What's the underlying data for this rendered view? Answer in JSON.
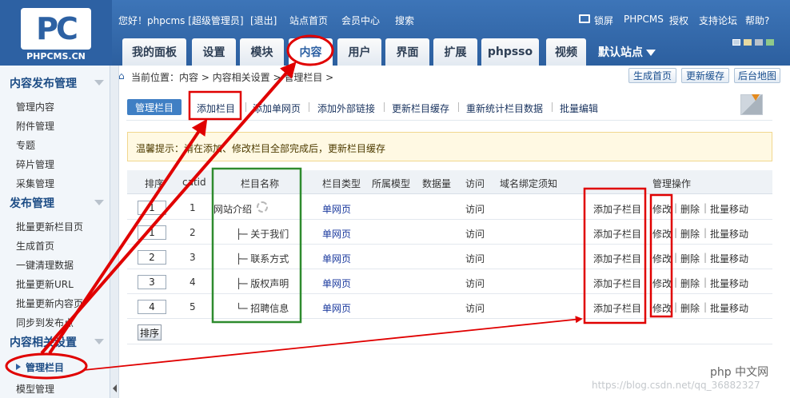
{
  "header": {
    "logo_glyph": "PC",
    "logo_text": "PHPCMS.CN",
    "greeting": "您好！phpcms [超级管理员]",
    "logout": "[退出]",
    "site_home": "站点首页",
    "member_center": "会员中心",
    "search": "搜索",
    "lock_screen": "锁屏",
    "phpcms": "PHPCMS",
    "license": "授权",
    "support_forum": "支持论坛",
    "help": "帮助?",
    "tabs": [
      "我的面板",
      "设置",
      "模块",
      "内容",
      "用户",
      "界面",
      "扩展",
      "phpsso",
      "视频"
    ],
    "site_select": "默认站点"
  },
  "sidebar": {
    "group1_title": "内容发布管理",
    "group1_items": [
      "管理内容",
      "附件管理",
      "专题",
      "碎片管理",
      "采集管理"
    ],
    "group2_title": "发布管理",
    "group2_items": [
      "批量更新栏目页",
      "生成首页",
      "一键清理数据",
      "批量更新URL",
      "批量更新内容页",
      "同步到发布点"
    ],
    "group3_title": "内容相关设置",
    "group3_items": [
      "管理栏目",
      "模型管理"
    ]
  },
  "breadcrumb": "当前位置：内容 > 内容相关设置 > 管理栏目 >",
  "top_buttons": {
    "generate_home": "生成首页",
    "update_cache": "更新缓存",
    "backend_map": "后台地图"
  },
  "subnav": [
    "管理栏目",
    "添加栏目",
    "添加单网页",
    "添加外部链接",
    "更新栏目缓存",
    "重新统计栏目数据",
    "批量编辑"
  ],
  "notice": "温馨提示：请在添加、修改栏目全部完成后，更新栏目缓存",
  "table": {
    "headers": {
      "sort": "排序",
      "catid": "catid",
      "name": "栏目名称",
      "type": "栏目类型",
      "model": "所属模型",
      "count": "数据量",
      "visit": "访问",
      "domain": "域名绑定须知",
      "ops": "管理操作"
    },
    "rows": [
      {
        "sort": "1",
        "catid": "1",
        "name": "网站介绍",
        "type": "单网页",
        "visit": "访问",
        "add_child": "添加子栏目",
        "edit": "修改",
        "delete": "删除",
        "batch_move": "批量移动"
      },
      {
        "sort": "1",
        "catid": "2",
        "name": "├─ 关于我们",
        "type": "单网页",
        "visit": "访问",
        "add_child": "添加子栏目",
        "edit": "修改",
        "delete": "删除",
        "batch_move": "批量移动"
      },
      {
        "sort": "2",
        "catid": "3",
        "name": "├─ 联系方式",
        "type": "单网页",
        "visit": "访问",
        "add_child": "添加子栏目",
        "edit": "修改",
        "delete": "删除",
        "batch_move": "批量移动"
      },
      {
        "sort": "3",
        "catid": "4",
        "name": "├─ 版权声明",
        "type": "单网页",
        "visit": "访问",
        "add_child": "添加子栏目",
        "edit": "修改",
        "delete": "删除",
        "batch_move": "批量移动"
      },
      {
        "sort": "4",
        "catid": "5",
        "name": "└─ 招聘信息",
        "type": "单网页",
        "visit": "访问",
        "add_child": "添加子栏目",
        "edit": "修改",
        "delete": "删除",
        "batch_move": "批量移动"
      }
    ],
    "sort_button": "排序"
  },
  "watermark": "https://blog.csdn.net/qq_36882327",
  "php_logo": "php 中文网",
  "colors": {
    "header_blue": "#2d61a3",
    "annotation_red": "#e00000",
    "annotation_green": "#2e8b2e"
  }
}
